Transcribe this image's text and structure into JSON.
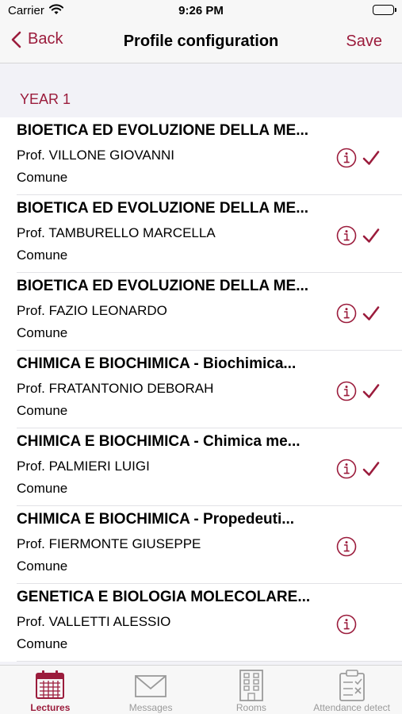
{
  "status": {
    "carrier": "Carrier",
    "time": "9:26 PM"
  },
  "nav": {
    "back_label": "Back",
    "title": "Profile configuration",
    "save_label": "Save"
  },
  "section": {
    "title": "YEAR 1"
  },
  "courses": [
    {
      "title": "BIOETICA ED EVOLUZIONE DELLA ME...",
      "professor": "Prof. VILLONE GIOVANNI",
      "type": "Comune",
      "selected": true
    },
    {
      "title": "BIOETICA ED EVOLUZIONE DELLA ME...",
      "professor": "Prof. TAMBURELLO MARCELLA",
      "type": "Comune",
      "selected": true
    },
    {
      "title": "BIOETICA ED EVOLUZIONE DELLA ME...",
      "professor": "Prof. FAZIO LEONARDO",
      "type": "Comune",
      "selected": true
    },
    {
      "title": "CHIMICA E BIOCHIMICA - Biochimica...",
      "professor": "Prof. FRATANTONIO DEBORAH",
      "type": "Comune",
      "selected": true
    },
    {
      "title": "CHIMICA E BIOCHIMICA - Chimica me...",
      "professor": "Prof. PALMIERI LUIGI",
      "type": "Comune",
      "selected": true
    },
    {
      "title": "CHIMICA E BIOCHIMICA - Propedeuti...",
      "professor": "Prof. FIERMONTE GIUSEPPE",
      "type": "Comune",
      "selected": false
    },
    {
      "title": "GENETICA E BIOLOGIA MOLECOLARE...",
      "professor": "Prof. VALLETTI ALESSIO",
      "type": "Comune",
      "selected": false
    }
  ],
  "tabs": [
    {
      "label": "Lectures",
      "icon": "calendar-icon",
      "active": true
    },
    {
      "label": "Messages",
      "icon": "envelope-icon",
      "active": false
    },
    {
      "label": "Rooms",
      "icon": "building-icon",
      "active": false
    },
    {
      "label": "Attendance detect",
      "icon": "clipboard-icon",
      "active": false
    }
  ],
  "colors": {
    "accent": "#9b1c3c",
    "tab_inactive": "#9a9a9a"
  }
}
